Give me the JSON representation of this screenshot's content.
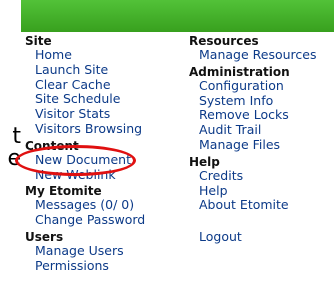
{
  "side_text": [
    "t",
    "e"
  ],
  "left_column": [
    {
      "heading": "Site",
      "items": [
        "Home",
        "Launch Site",
        "Clear Cache",
        "Site Schedule",
        "Visitor Stats",
        "Visitors Browsing"
      ]
    },
    {
      "heading": "Content",
      "items": [
        "New Document",
        "New Weblink"
      ]
    },
    {
      "heading": "My Etomite",
      "items": [
        "Messages (0/ 0)",
        "Change Password"
      ]
    },
    {
      "heading": "Users",
      "items": [
        "Manage Users",
        "Permissions"
      ]
    }
  ],
  "right_column": [
    {
      "heading": "Resources",
      "items": [
        "Manage Resources"
      ]
    },
    {
      "heading": "Administration",
      "items": [
        "Configuration",
        "System Info",
        "Remove Locks",
        "Audit Trail",
        "Manage Files"
      ]
    },
    {
      "heading": "Help",
      "items": [
        "Credits",
        "Help",
        "About Etomite"
      ]
    },
    {
      "heading": "",
      "items": [
        "Logout"
      ]
    }
  ],
  "colors": {
    "header_green": "#45b02a",
    "link_blue": "#0c3a88",
    "highlight_red": "#e01010"
  }
}
